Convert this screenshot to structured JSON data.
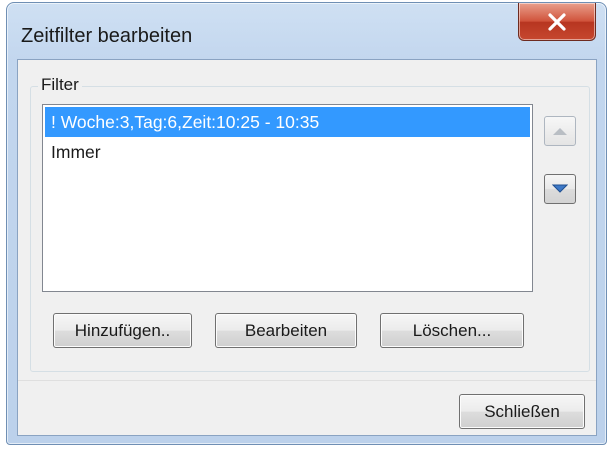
{
  "window": {
    "title": "Zeitfilter bearbeiten"
  },
  "filter_group": {
    "label": "Filter",
    "items": [
      {
        "label": "! Woche:3,Tag:6,Zeit:10:25 - 10:35",
        "selected": true
      },
      {
        "label": "Immer",
        "selected": false
      }
    ],
    "move_up": {
      "icon": "arrow-up-icon",
      "enabled": false
    },
    "move_down": {
      "icon": "arrow-down-icon",
      "enabled": true
    }
  },
  "buttons": {
    "add": "Hinzufügen..",
    "edit": "Bearbeiten",
    "delete": "Löschen...",
    "close": "Schließen"
  },
  "colors": {
    "selection": "#3399ff",
    "close_button": "#c6472f",
    "arrow_enabled": "#3d78c6"
  }
}
